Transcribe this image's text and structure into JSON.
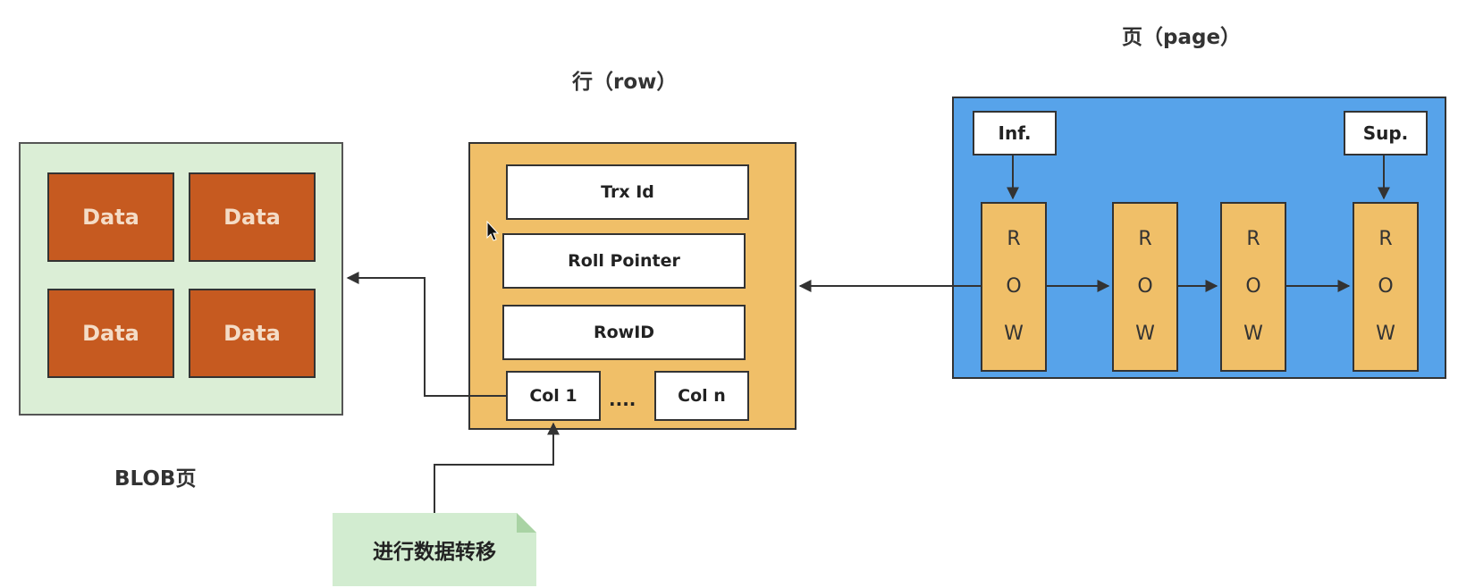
{
  "titles": {
    "row": "行（row）",
    "page": "页（page）",
    "blob": "BLOB页"
  },
  "blob_page": {
    "cells": [
      "Data",
      "Data",
      "Data",
      "Data"
    ]
  },
  "row": {
    "fields": [
      "Trx Id",
      "Roll Pointer",
      "RowID"
    ],
    "col_first": "Col 1",
    "col_ellipsis": "....",
    "col_last": "Col n"
  },
  "page": {
    "inf_label": "Inf.",
    "sup_label": "Sup.",
    "row_letters": [
      "R",
      "O",
      "W"
    ]
  },
  "note": {
    "text": "进行数据转移"
  },
  "colors": {
    "blob_bg": "#dbeed6",
    "data_cell": "#c65a20",
    "row_bg": "#f0bf68",
    "page_bg": "#57a3ea",
    "note_bg": "#d2ecd0"
  }
}
